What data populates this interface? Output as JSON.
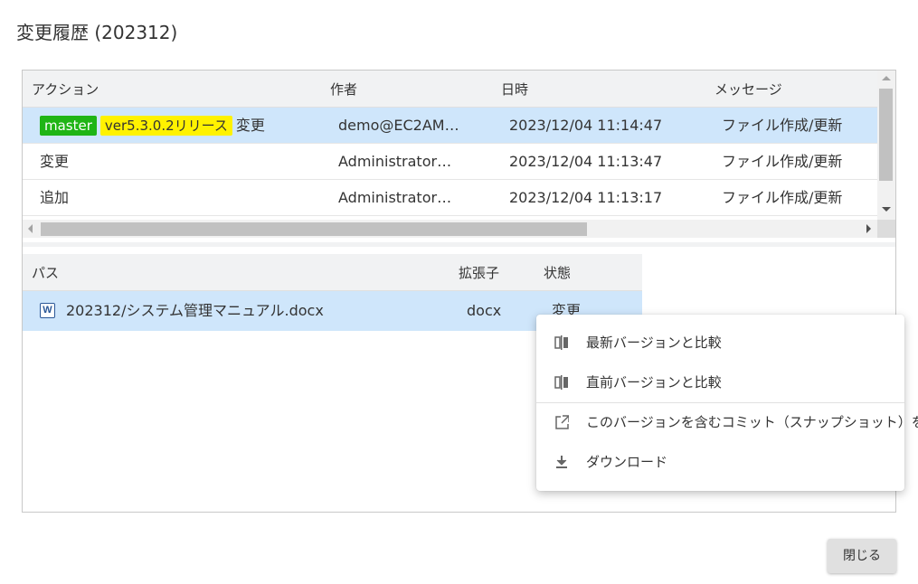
{
  "dialog": {
    "title": "変更履歴 (202312)"
  },
  "history": {
    "columns": {
      "action": "アクション",
      "author": "作者",
      "datetime": "日時",
      "message": "メッセージ"
    },
    "rows": [
      {
        "tags": [
          {
            "label": "master",
            "color": "#1fb515"
          },
          {
            "label": "ver5.3.0.2リリース",
            "color": "#fff200"
          }
        ],
        "action": "変更",
        "author": "demo@EC2AM…",
        "datetime": "2023/12/04 11:14:47",
        "message": "ファイル作成/更新",
        "selected": true
      },
      {
        "tags": [],
        "action": "変更",
        "author": "Administrator…",
        "datetime": "2023/12/04 11:13:47",
        "message": "ファイル作成/更新",
        "selected": false
      },
      {
        "tags": [],
        "action": "追加",
        "author": "Administrator…",
        "datetime": "2023/12/04 11:13:17",
        "message": "ファイル作成/更新",
        "selected": false
      }
    ]
  },
  "files": {
    "columns": {
      "path": "パス",
      "ext": "拡張子",
      "status": "状態"
    },
    "rows": [
      {
        "icon": "word-doc-icon",
        "path": "202312/システム管理マニュアル.docx",
        "ext": "docx",
        "status": "変更"
      }
    ]
  },
  "context_menu": {
    "items": [
      {
        "icon": "compare-icon",
        "label": "最新バージョンと比較"
      },
      {
        "icon": "compare-icon",
        "label": "直前バージョンと比較"
      },
      {
        "icon": "open-external-icon",
        "label": "このバージョンを含むコミット（スナップショット）を開く"
      },
      {
        "icon": "download-icon",
        "label": "ダウンロード"
      }
    ]
  },
  "buttons": {
    "close": "閉じる"
  }
}
